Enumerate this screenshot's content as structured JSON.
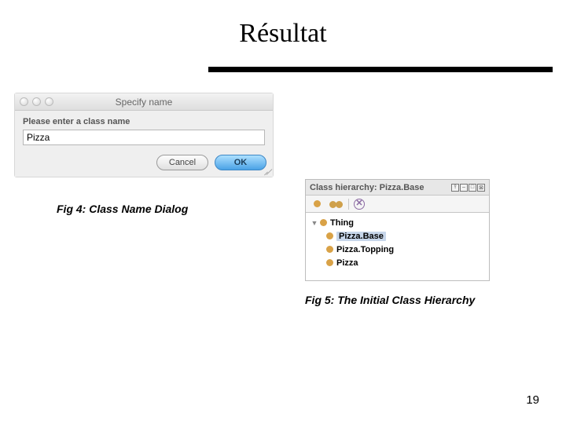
{
  "page": {
    "title": "Résultat",
    "number": "19"
  },
  "dialog": {
    "window_title": "Specify name",
    "prompt": "Please enter a class name",
    "input_value": "Pizza",
    "cancel_label": "Cancel",
    "ok_label": "OK",
    "caption": "Fig 4: Class Name Dialog"
  },
  "hierarchy": {
    "panel_title_prefix": "Class hierarchy: ",
    "selected_class": "Pizza.Base",
    "toolbar_delete_glyph": "✕",
    "tree": {
      "root": "Thing",
      "children": [
        "Pizza.Base",
        "Pizza.Topping",
        "Pizza"
      ]
    },
    "caption": "Fig 5: The Initial Class Hierarchy"
  }
}
